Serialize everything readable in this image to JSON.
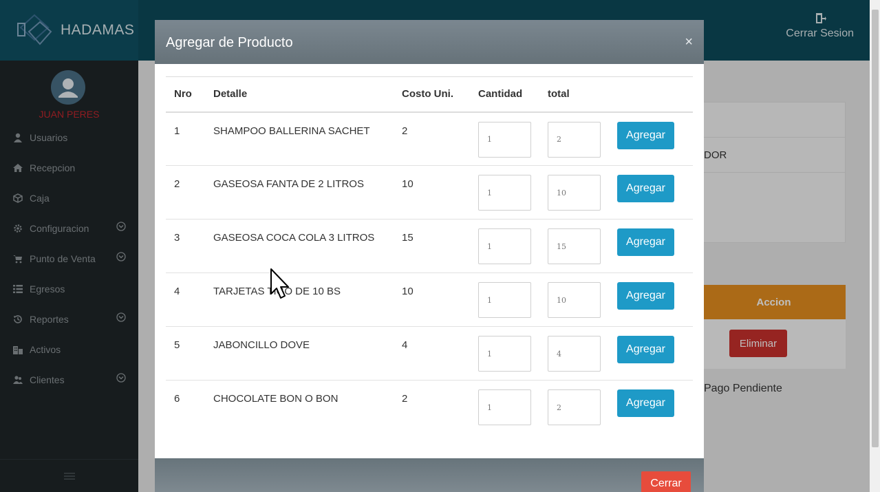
{
  "app": {
    "brand": "HADAMAS",
    "logout_label": "Cerrar Sesion"
  },
  "user": {
    "name": "JUAN PERES"
  },
  "sidebar": {
    "items": [
      {
        "label": "Usuarios",
        "icon": "user-icon",
        "has_children": false
      },
      {
        "label": "Recepcion",
        "icon": "home-icon",
        "has_children": false
      },
      {
        "label": "Caja",
        "icon": "cube-icon",
        "has_children": false
      },
      {
        "label": "Configuracion",
        "icon": "gear-icon",
        "has_children": true
      },
      {
        "label": "Punto de Venta",
        "icon": "cart-icon",
        "has_children": true
      },
      {
        "label": "Egresos",
        "icon": "list-icon",
        "has_children": false
      },
      {
        "label": "Reportes",
        "icon": "history-icon",
        "has_children": true
      },
      {
        "label": "Activos",
        "icon": "building-icon",
        "has_children": false
      },
      {
        "label": "Clientes",
        "icon": "users-icon",
        "has_children": true
      }
    ]
  },
  "background": {
    "partial_text": "DOR",
    "accion_header": "Accion",
    "eliminar_label": "Eliminar",
    "status_text": "Pago Pendiente"
  },
  "modal": {
    "title": "Agregar de Producto",
    "close_symbol": "×",
    "columns": [
      "Nro",
      "Detalle",
      "Costo Uni.",
      "Cantidad",
      "total"
    ],
    "rows": [
      {
        "nro": "1",
        "detalle": "SHAMPOO BALLERINA SACHET",
        "costo": "2",
        "cantidad": "1",
        "total": "2"
      },
      {
        "nro": "2",
        "detalle": "GASEOSA FANTA DE 2 LITROS",
        "costo": "10",
        "cantidad": "1",
        "total": "10"
      },
      {
        "nro": "3",
        "detalle": "GASEOSA COCA COLA 3 LITROS",
        "costo": "15",
        "cantidad": "1",
        "total": "15"
      },
      {
        "nro": "4",
        "detalle": "TARJETAS TIGO DE 10 BS",
        "costo": "10",
        "cantidad": "1",
        "total": "10"
      },
      {
        "nro": "5",
        "detalle": "JABONCILLO DOVE",
        "costo": "4",
        "cantidad": "1",
        "total": "4"
      },
      {
        "nro": "6",
        "detalle": "CHOCOLATE BON O BON",
        "costo": "2",
        "cantidad": "1",
        "total": "2"
      }
    ],
    "add_label": "Agregar",
    "close_label": "Cerrar"
  },
  "colors": {
    "header_bg": "#0d4a5a",
    "sidebar_bg": "#1f2629",
    "username": "#c0262d",
    "agregar_button": "#1e9ac7",
    "cerrar_button": "#e74c3c",
    "accion_header": "#e58e1f",
    "eliminar_button": "#c9302c"
  }
}
